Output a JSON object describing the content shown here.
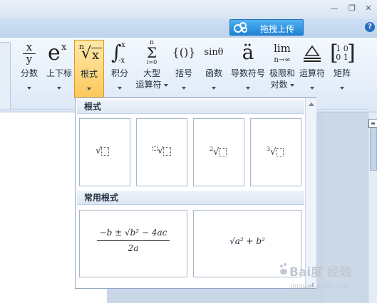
{
  "titlebar": {
    "minimize_glyph": "—",
    "restore_glyph": "❐",
    "close_glyph": "✕"
  },
  "tabstrip": {
    "cloud_button_label": "拖拽上传",
    "help_glyph": "?"
  },
  "ribbon": {
    "buttons": [
      {
        "id": "fraction",
        "label": "分数"
      },
      {
        "id": "script",
        "label": "上下标"
      },
      {
        "id": "radical",
        "label": "根式"
      },
      {
        "id": "integral",
        "label": "积分"
      },
      {
        "id": "large-operator",
        "label": "大型",
        "label2": "运算符"
      },
      {
        "id": "bracket",
        "label": "括号"
      },
      {
        "id": "function",
        "label": "函数"
      },
      {
        "id": "accent",
        "label": "导数符号"
      },
      {
        "id": "limit-log",
        "label": "极限和",
        "label2": "对数"
      },
      {
        "id": "operator",
        "label": "运算符"
      },
      {
        "id": "matrix",
        "label": "矩阵"
      }
    ],
    "symbols": {
      "fraction_top": "x",
      "fraction_bottom": "y",
      "script_base": "e",
      "script_sup": "x",
      "radical_index": "n",
      "radical_body": "x",
      "integral_sup": "x",
      "integral_sub": "-x",
      "sum_sup": "n",
      "sum_sub": "i=0",
      "bracket": "{()}",
      "function": "sinθ",
      "accent": "ä",
      "limit_top": "lim",
      "limit_sub": "n→∞",
      "matrix_r1": "1 0",
      "matrix_r2": "0 1"
    },
    "active_button": "radical"
  },
  "dropdown": {
    "section1_title": "根式",
    "section2_title": "常用根式",
    "tiles": [
      {
        "name": "square-root"
      },
      {
        "name": "nth-root"
      },
      {
        "name": "square-root-with-degree",
        "index": "2"
      },
      {
        "name": "cube-root",
        "index": "3"
      }
    ],
    "formula1_num": "−b ± √b² − 4ac",
    "formula1_den": "2a",
    "formula2": "√a² + b²"
  },
  "watermark": {
    "line1": "Bai度 经验",
    "line2": "jingyan.baidu.com"
  }
}
